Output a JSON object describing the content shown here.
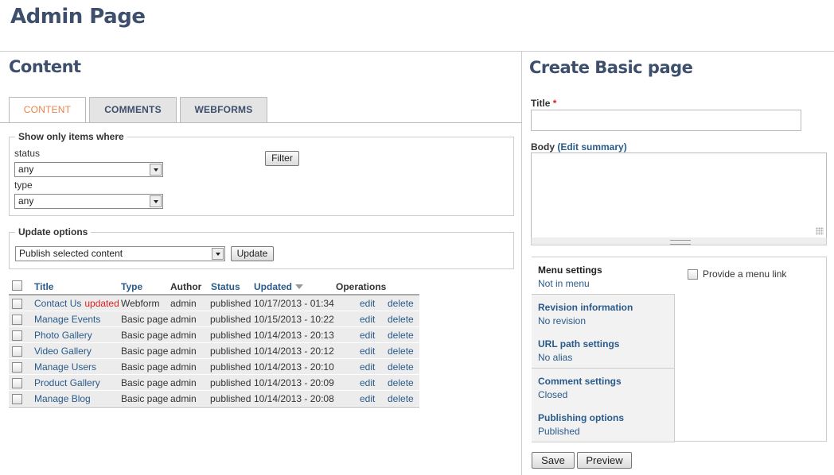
{
  "page": {
    "title": "Admin Page"
  },
  "content": {
    "heading": "Content",
    "tabs": [
      {
        "label": "CONTENT",
        "active": true
      },
      {
        "label": "COMMENTS",
        "active": false
      },
      {
        "label": "WEBFORMS",
        "active": false
      }
    ],
    "filter": {
      "legend": "Show only items where",
      "status_label": "status",
      "status_value": "any",
      "type_label": "type",
      "type_value": "any",
      "button": "Filter"
    },
    "update": {
      "legend": "Update options",
      "action_value": "Publish selected content",
      "button": "Update"
    },
    "table": {
      "headers": {
        "title": "Title",
        "type": "Type",
        "author": "Author",
        "status": "Status",
        "updated": "Updated",
        "operations": "Operations"
      },
      "rows": [
        {
          "title": "Contact Us",
          "mark": "updated",
          "type": "Webform",
          "author": "admin",
          "status": "published",
          "updated": "10/17/2013 - 01:34",
          "edit": "edit",
          "delete": "delete"
        },
        {
          "title": "Manage Events",
          "mark": "",
          "type": "Basic page",
          "author": "admin",
          "status": "published",
          "updated": "10/15/2013 - 10:22",
          "edit": "edit",
          "delete": "delete"
        },
        {
          "title": "Photo Gallery",
          "mark": "",
          "type": "Basic page",
          "author": "admin",
          "status": "published",
          "updated": "10/14/2013 - 20:13",
          "edit": "edit",
          "delete": "delete"
        },
        {
          "title": "Video Gallery",
          "mark": "",
          "type": "Basic page",
          "author": "admin",
          "status": "published",
          "updated": "10/14/2013 - 20:12",
          "edit": "edit",
          "delete": "delete"
        },
        {
          "title": "Manage Users",
          "mark": "",
          "type": "Basic page",
          "author": "admin",
          "status": "published",
          "updated": "10/14/2013 - 20:10",
          "edit": "edit",
          "delete": "delete"
        },
        {
          "title": "Product Gallery",
          "mark": "",
          "type": "Basic page",
          "author": "admin",
          "status": "published",
          "updated": "10/14/2013 - 20:09",
          "edit": "edit",
          "delete": "delete"
        },
        {
          "title": "Manage Blog",
          "mark": "",
          "type": "Basic page",
          "author": "admin",
          "status": "published",
          "updated": "10/14/2013 - 20:08",
          "edit": "edit",
          "delete": "delete"
        }
      ]
    }
  },
  "create": {
    "heading": "Create Basic page",
    "title_label": "Title",
    "required_mark": "*",
    "body_label": "Body",
    "edit_summary": "(Edit summary)",
    "vertical_tabs": [
      {
        "title": "Menu settings",
        "summary": "Not in menu",
        "selected": true
      },
      {
        "title": "Revision information",
        "summary": "No revision",
        "selected": false
      },
      {
        "title": "URL path settings",
        "summary": "No alias",
        "selected": false
      },
      {
        "title": "Comment settings",
        "summary": "Closed",
        "selected": false
      },
      {
        "title": "Publishing options",
        "summary": "Published",
        "selected": false
      }
    ],
    "menu_link_label": "Provide a menu link",
    "save_button": "Save",
    "preview_button": "Preview"
  }
}
